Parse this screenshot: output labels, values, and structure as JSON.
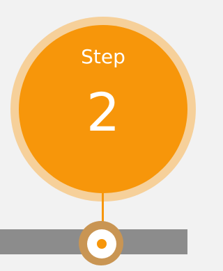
{
  "step": {
    "label": "Step",
    "number": "2"
  },
  "colors": {
    "accent": "#f7960a",
    "halo": "#f6d09a",
    "track": "#8c8c8c",
    "background": "#f2f2f2"
  }
}
